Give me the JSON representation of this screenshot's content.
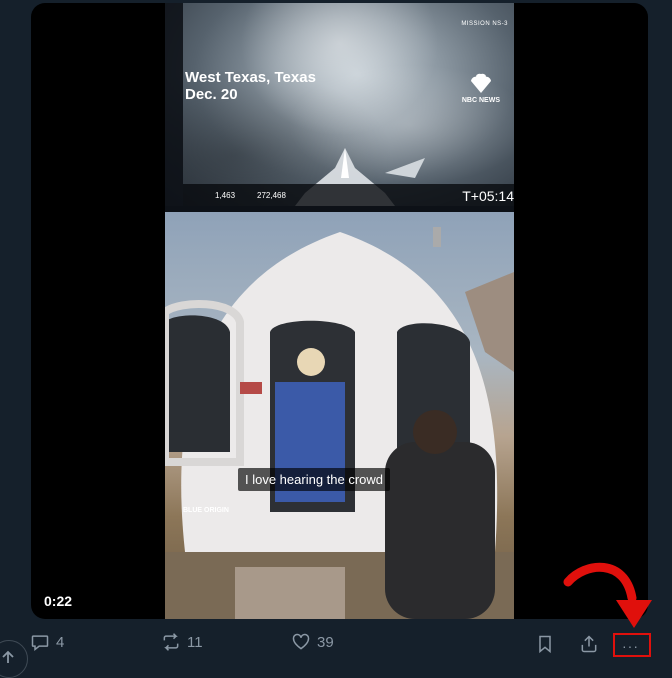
{
  "video": {
    "location_line1": "West Texas, Texas",
    "location_line2": "Dec. 20",
    "mission": "MISSION NS-3",
    "network": "NBC NEWS",
    "timer": "T+05:14",
    "altitude": "1,463",
    "velocity": "272,468",
    "capsule_label": "RSS KARMAN LINE",
    "subtitle": "I love hearing the crowd",
    "watermark": "BLUE ORIGIN",
    "duration": "0:22"
  },
  "actions": {
    "reply_count": "4",
    "repost_count": "11",
    "like_count": "39",
    "more_label": "···"
  },
  "colors": {
    "background": "#15202b",
    "icon_gray": "#8b98a5",
    "annotation_red": "#e0100c"
  }
}
